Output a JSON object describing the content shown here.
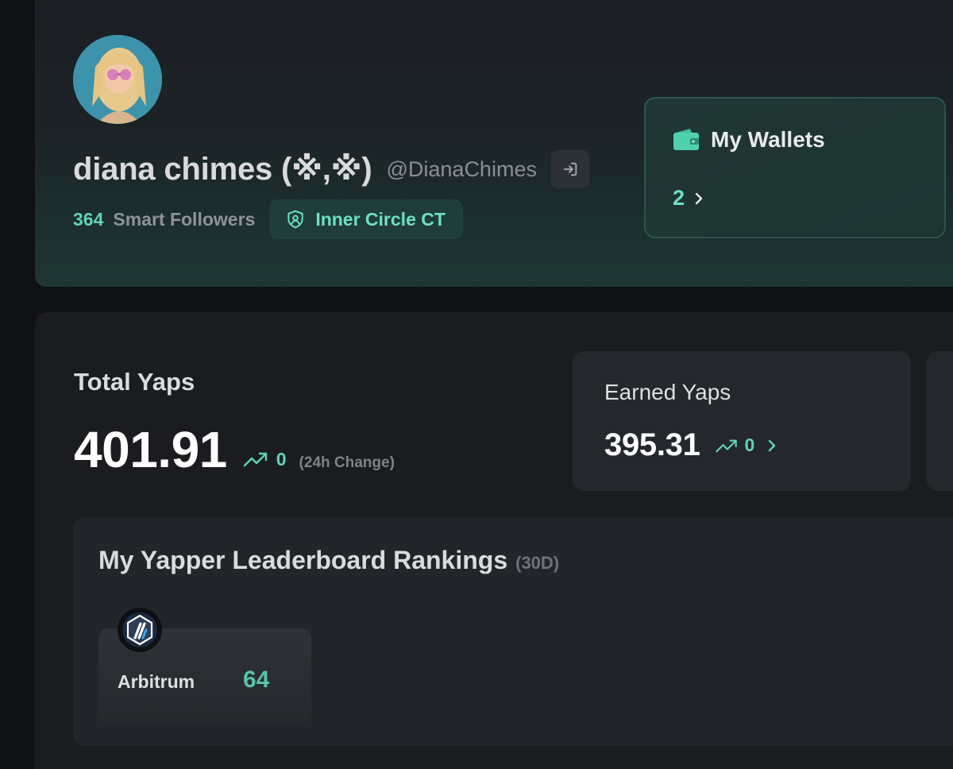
{
  "profile": {
    "display_name": "diana chimes (※,※)",
    "handle": "@DianaChimes",
    "smart_followers_count": "364",
    "smart_followers_label": "Smart Followers",
    "badge_label": "Inner Circle CT"
  },
  "wallets": {
    "title": "My Wallets",
    "count": "2"
  },
  "stats": {
    "total_label": "Total Yaps",
    "total_value": "401.91",
    "total_change": "0",
    "total_change_note": "(24h Change)",
    "earned_label": "Earned Yaps",
    "earned_value": "395.31",
    "earned_change": "0"
  },
  "leaderboard": {
    "title": "My Yapper Leaderboard Rankings",
    "period": "(30D)",
    "rankings": [
      {
        "name": "Arbitrum",
        "rank": "64"
      }
    ]
  },
  "colors": {
    "accent": "#5fd4b8",
    "panel": "#1a1c20",
    "background": "#101115"
  },
  "icons": {
    "login": "login-icon",
    "shield": "shield-icon",
    "wallet": "wallet-icon",
    "chevron": "chevron-right-icon",
    "trend": "trending-up-icon",
    "arbitrum": "arbitrum-logo-icon"
  }
}
